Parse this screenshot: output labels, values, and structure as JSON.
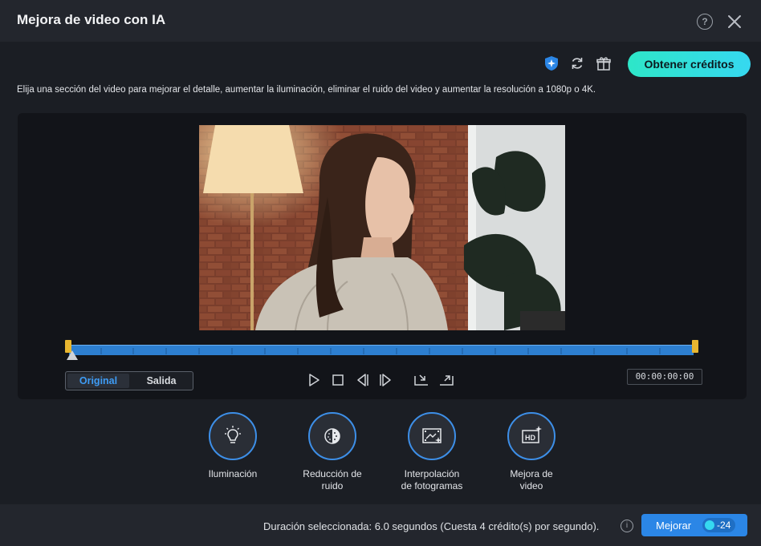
{
  "window": {
    "title": "Mejora de video con IA"
  },
  "toolbar": {
    "credits_button": "Obtener créditos"
  },
  "description": "Elija una sección del video para mejorar el detalle, aumentar la iluminación, eliminar el ruido del video y aumentar la resolución a 1080p o 4K.",
  "preview": {
    "toggle": {
      "original": "Original",
      "output": "Salida",
      "selected": "Original"
    },
    "timecode": "00:00:00:00"
  },
  "features": [
    {
      "label_line1": "Iluminación",
      "label_line2": ""
    },
    {
      "label_line1": "Reducción de",
      "label_line2": "ruido"
    },
    {
      "label_line1": "Interpolación",
      "label_line2": "de fotogramas"
    },
    {
      "label_line1": "Mejora de",
      "label_line2": "video"
    }
  ],
  "footer": {
    "duration_text": "Duración seleccionada: 6.0 segundos (Cuesta 4 crédito(s) por segundo).",
    "enhance_button": "Mejorar",
    "cost": "-24"
  },
  "colors": {
    "accent": "#2b86e6",
    "credits_gradient_start": "#2ee6c8",
    "handle": "#e8b630"
  }
}
